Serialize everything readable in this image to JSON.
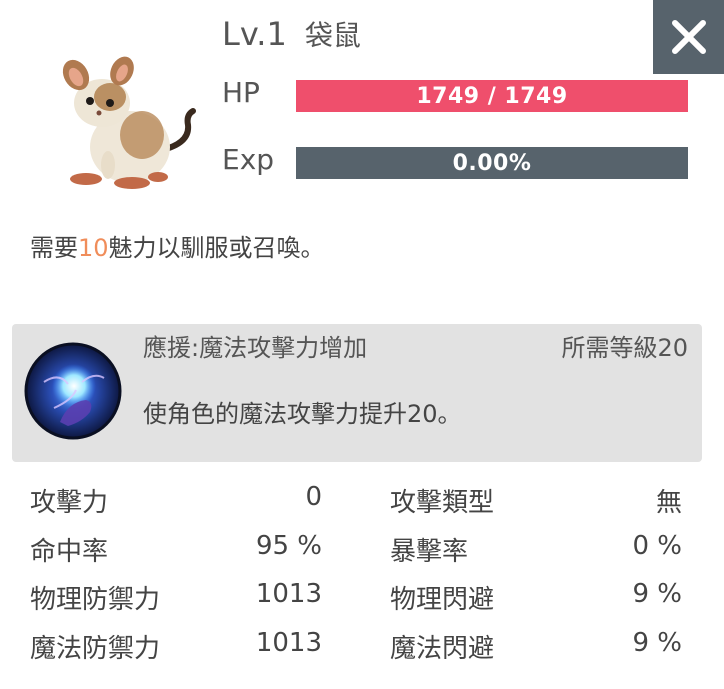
{
  "header": {
    "level": "Lv.1",
    "name": "袋鼠"
  },
  "close_icon": "close-icon",
  "hp": {
    "label": "HP",
    "text": "1749 / 1749",
    "current": 1749,
    "max": 1749,
    "color": "#ef4f6c"
  },
  "exp": {
    "label": "Exp",
    "text": "0.00%",
    "progress": 0.0,
    "color": "#57636c"
  },
  "tame": {
    "prefix": "需要",
    "charm": "10",
    "suffix": "魅力以馴服或召喚。",
    "charm_color": "#f08d5a"
  },
  "skill": {
    "icon": "magic-orb-icon",
    "name": "應援:魔法攻擊力增加",
    "requirement": "所需等級20",
    "description": "使角色的魔法攻擊力提升20。"
  },
  "stats": [
    {
      "l1": "攻擊力",
      "v1": "0",
      "l2": "攻擊類型",
      "v2": "無"
    },
    {
      "l1": "命中率",
      "v1": "95 %",
      "l2": "暴擊率",
      "v2": "0 %"
    },
    {
      "l1": "物理防禦力",
      "v1": "1013",
      "l2": "物理閃避",
      "v2": "9 %"
    },
    {
      "l1": "魔法防禦力",
      "v1": "1013",
      "l2": "魔法閃避",
      "v2": "9 %"
    }
  ]
}
